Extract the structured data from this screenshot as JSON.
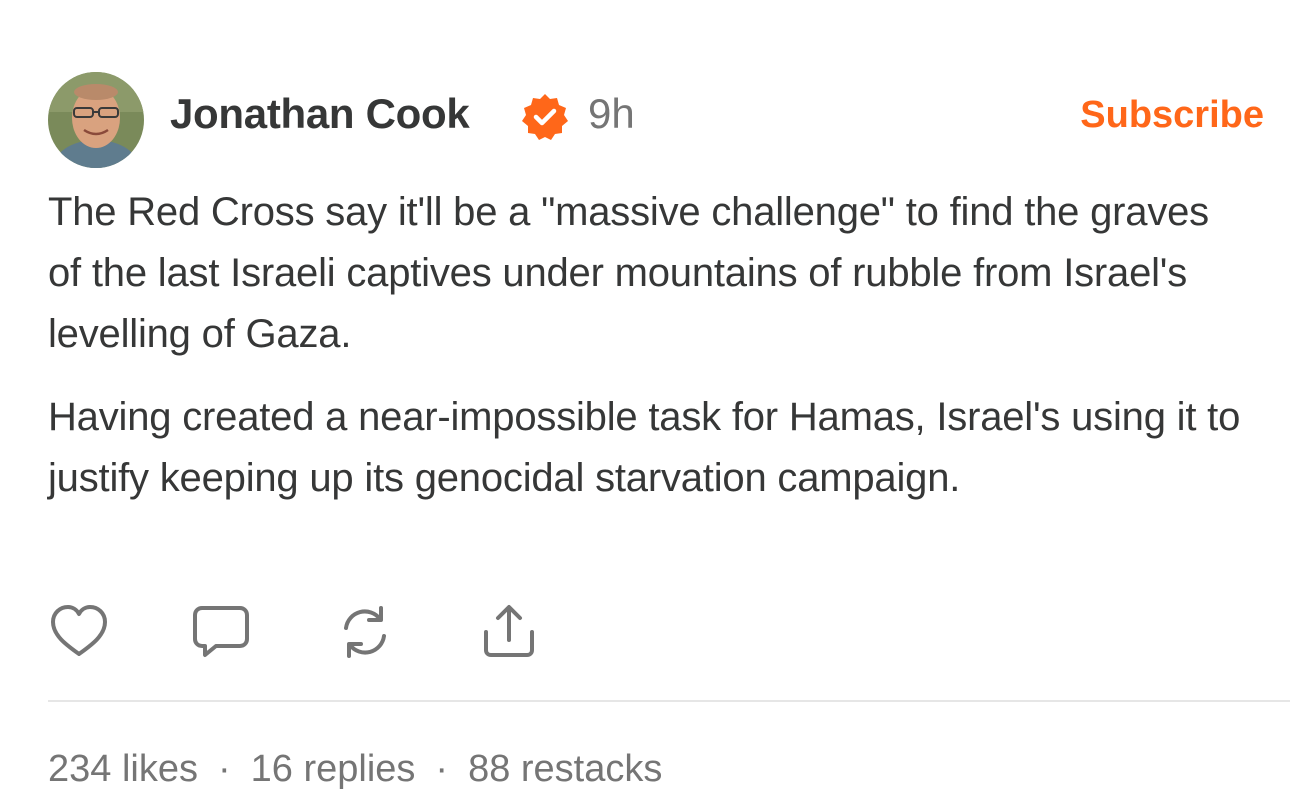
{
  "post": {
    "author": "Jonathan Cook",
    "verified_icon": "verified-check-icon",
    "time": "9h",
    "subscribe_label": "Subscribe",
    "paragraphs": [
      "The Red Cross say it'll be a \"massive challenge\" to find the graves of the last Israeli captives under mountains of rubble from Israel's levelling of Gaza.",
      "Having created a near-impossible task for Hamas, Israel's using it to justify keeping up its genocidal starvation campaign."
    ],
    "actions": [
      "heart-icon",
      "comment-icon",
      "restack-icon",
      "share-icon"
    ],
    "stats": {
      "likes": "234 likes",
      "replies": "16 replies",
      "restacks": "88 restacks",
      "separator": "·"
    }
  },
  "colors": {
    "accent": "#ff6719",
    "text": "#363737",
    "muted": "#757575",
    "divider": "#e6e6e6"
  }
}
